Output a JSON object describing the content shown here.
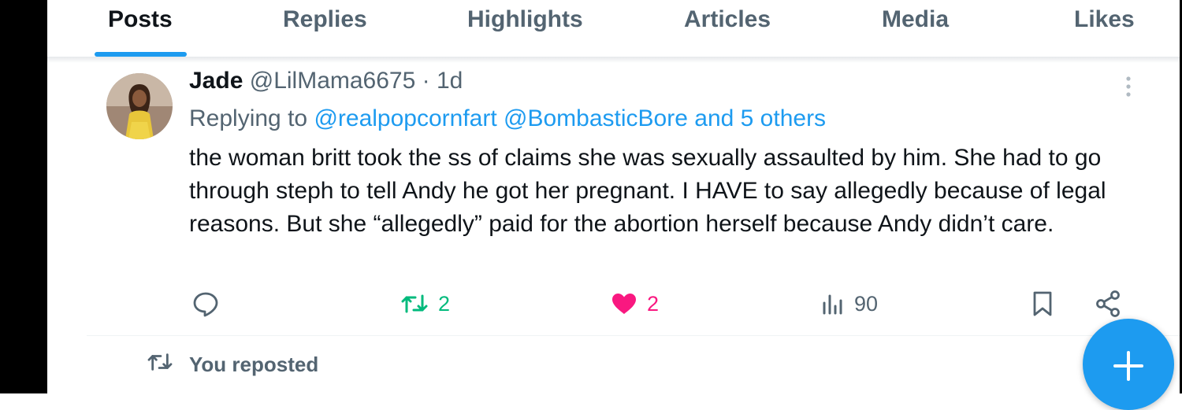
{
  "tabs": [
    {
      "label": "Posts",
      "active": true
    },
    {
      "label": "Replies",
      "active": false
    },
    {
      "label": "Highlights",
      "active": false
    },
    {
      "label": "Articles",
      "active": false
    },
    {
      "label": "Media",
      "active": false
    },
    {
      "label": "Likes",
      "active": false
    }
  ],
  "post": {
    "author_name": "Jade",
    "author_handle": "@LilMama6675",
    "separator": "·",
    "time": "1d",
    "avatar_icon": "user-avatar-photo",
    "replying_prefix": "Replying to",
    "replying_user1": "@realpopcornfart",
    "replying_user2": "@BombasticBore",
    "replying_others": "and 5 others",
    "text": "the woman britt took the ss of claims she was sexually assaulted by him. She had to go through steph to tell Andy he got her pregnant. I HAVE to say allegedly because of legal reasons. But she “allegedly” paid for the abortion herself because Andy didn’t care.",
    "actions": {
      "reply_icon": "reply-bubble-icon",
      "retweet_icon": "retweet-icon",
      "retweet_count": "2",
      "like_icon": "heart-icon",
      "like_count": "2",
      "views_icon": "views-chart-icon",
      "views_count": "90",
      "bookmark_icon": "bookmark-icon",
      "share_icon": "share-icon"
    }
  },
  "reposted_banner": {
    "icon": "retweet-icon",
    "label": "You reposted"
  },
  "fab": {
    "icon": "plus-icon"
  },
  "colors": {
    "accent": "#1d9bf0",
    "retweet_green": "#00ba7c",
    "like_pink": "#f91880",
    "text_primary": "#0f1419",
    "text_secondary": "#536471"
  }
}
